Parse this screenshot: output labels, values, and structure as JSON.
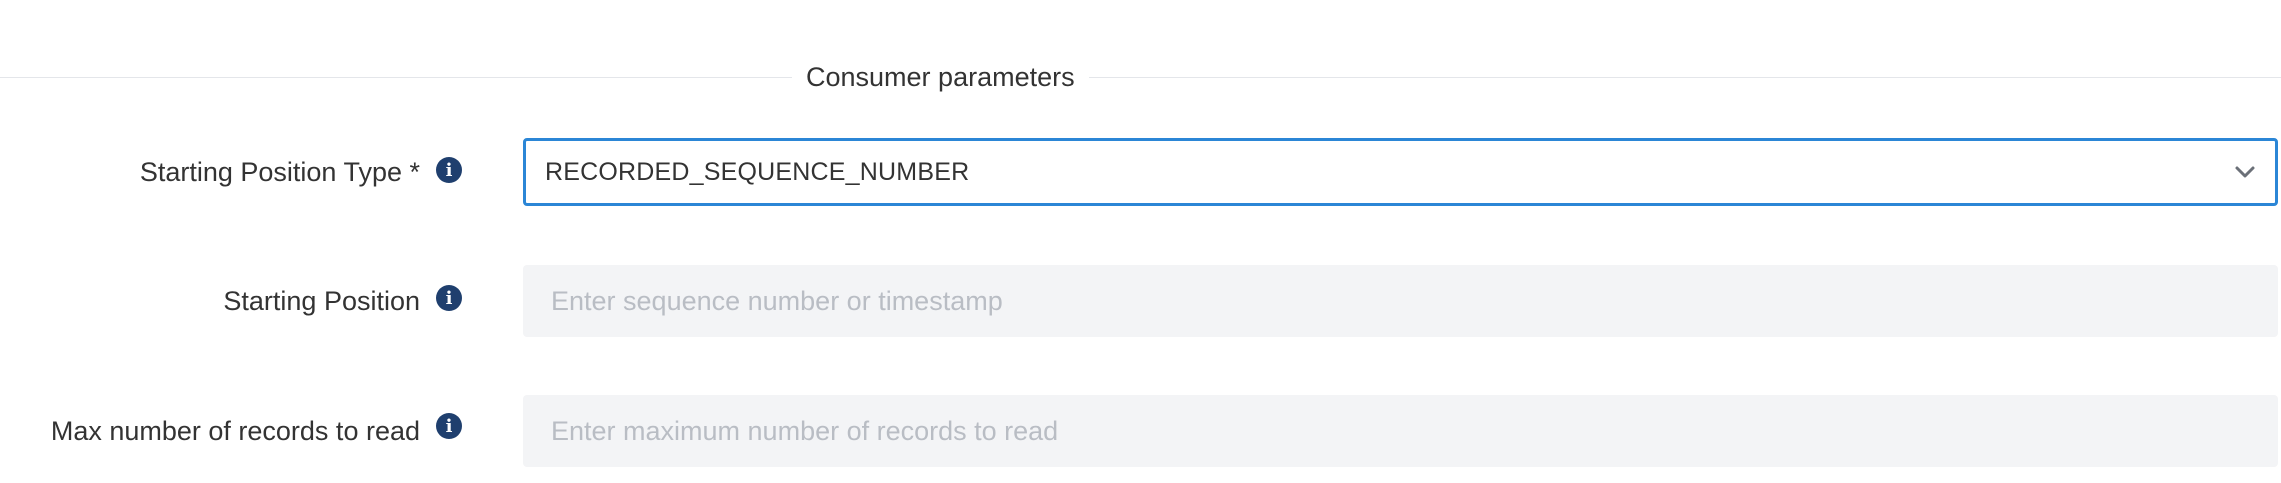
{
  "section": {
    "title": "Consumer parameters"
  },
  "fields": {
    "starting_position_type": {
      "label": "Starting Position Type *",
      "value": "RECORDED_SEQUENCE_NUMBER",
      "icon": "info-icon"
    },
    "starting_position": {
      "label": "Starting Position",
      "value": "",
      "placeholder": "Enter sequence number or timestamp",
      "icon": "info-icon"
    },
    "max_records": {
      "label": "Max number of records to read",
      "value": "",
      "placeholder": "Enter maximum number of records to read",
      "icon": "info-icon"
    }
  },
  "colors": {
    "focus_border": "#2b86d6",
    "info_icon_bg": "#1f3f6e",
    "input_bg": "#f3f4f6",
    "placeholder": "#b9bdc4",
    "text": "#333333"
  }
}
